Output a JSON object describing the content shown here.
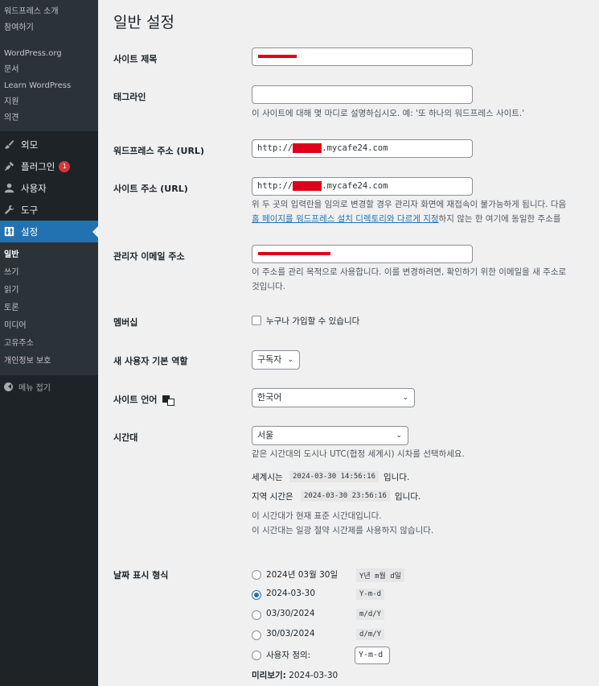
{
  "sidebar": {
    "top_items": [
      "워드프레스 소개",
      "참여하기"
    ],
    "links": [
      "WordPress.org",
      "문서",
      "Learn WordPress",
      "지원",
      "의견"
    ],
    "menu": [
      {
        "label": "외모",
        "icon": "brush-icon"
      },
      {
        "label": "플러그인",
        "icon": "plugin-icon",
        "badge": "1"
      },
      {
        "label": "사용자",
        "icon": "user-icon"
      },
      {
        "label": "도구",
        "icon": "wrench-icon"
      },
      {
        "label": "설정",
        "icon": "settings-icon"
      }
    ],
    "settings_submenu": [
      "일반",
      "쓰기",
      "읽기",
      "토론",
      "미디어",
      "고유주소",
      "개인정보 보호"
    ],
    "collapse_label": "메뉴 접기"
  },
  "page": {
    "title": "일반 설정",
    "site_title": {
      "label": "사이트 제목"
    },
    "tagline": {
      "label": "태그라인",
      "value": "",
      "desc": "이 사이트에 대해 몇 마디로 설명하십시오. 예: '또 하나의 워드프레스 사이트.'"
    },
    "wp_address": {
      "label": "워드프레스 주소 (URL)",
      "prefix": "http://",
      "suffix": ".mycafe24.com"
    },
    "site_address": {
      "label": "사이트 주소 (URL)",
      "prefix": "http://",
      "suffix": ".mycafe24.com",
      "desc_line1": "위 두 곳의 입력란을 임의로 변경할 경우 관리자 화면에 재접속이 불가능하게 됩니다. 다음",
      "desc_link": "홈 페이지를 워드프레스 설치 디렉토리와 다르게 지정",
      "desc_line2_rest": "하지 않는 한 여기에 동일한 주소를"
    },
    "admin_email": {
      "label": "관리자 이메일 주소",
      "desc_line1": "이 주소를 관리 목적으로 사용합니다. 이를 변경하려면, 확인하기 위한 이메일을 새 주소로",
      "desc_line2": "것입니다."
    },
    "membership": {
      "label": "멤버십",
      "checkbox_label": "누구나 가입할 수 있습니다"
    },
    "default_role": {
      "label": "새 사용자 기본 역할",
      "value": "구독자"
    },
    "site_language": {
      "label": "사이트 언어",
      "value": "한국어"
    },
    "timezone": {
      "label": "시간대",
      "value": "서울",
      "desc": "같은 시간대의 도시나 UTC(협정 세계시) 시차를 선택하세요.",
      "utc_prefix": "세계시는",
      "utc_time": "2024-03-30 14:56:16",
      "utc_suffix": "입니다.",
      "local_prefix": "지역 시간은",
      "local_time": "2024-03-30 23:56:16",
      "local_suffix": "입니다.",
      "note1": "이 시간대가 현재 표준 시간대입니다.",
      "note2": "이 시간대는 일광 절약 시간제를 사용하지 않습니다."
    },
    "date_format": {
      "label": "날짜 표시 형식",
      "options": [
        {
          "label": "2024년 03월 30일",
          "code": "Y년 m월 d일",
          "checked": false
        },
        {
          "label": "2024-03-30",
          "code": "Y-m-d",
          "checked": true
        },
        {
          "label": "03/30/2024",
          "code": "m/d/Y",
          "checked": false
        },
        {
          "label": "30/03/2024",
          "code": "d/m/Y",
          "checked": false
        }
      ],
      "custom_label": "사용자 정의:",
      "custom_value": "Y-m-d",
      "preview_label": "미리보기:",
      "preview_value": "2024-03-30"
    }
  }
}
